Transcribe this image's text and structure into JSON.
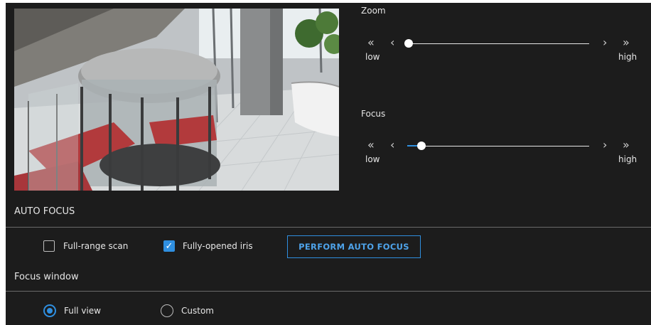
{
  "zoom": {
    "label": "Zoom",
    "low_label": "low",
    "high_label": "high",
    "level": 0.0
  },
  "focus": {
    "label": "Focus",
    "low_label": "low",
    "high_label": "high",
    "level": 0.07
  },
  "controls": {
    "far_left_glyph": "«",
    "left_glyph": "‹",
    "right_glyph": "›",
    "far_right_glyph": "»"
  },
  "auto_focus": {
    "title": "AUTO FOCUS",
    "full_range_scan_label": "Full-range scan",
    "full_range_scan_checked": false,
    "fully_opened_iris_label": "Fully-opened iris",
    "fully_opened_iris_checked": true,
    "button_label": "PERFORM AUTO FOCUS"
  },
  "focus_window": {
    "title": "Focus window",
    "options": [
      {
        "label": "Full view",
        "selected": true
      },
      {
        "label": "Custom",
        "selected": false
      }
    ]
  },
  "colors": {
    "accent": "#2f8fe0",
    "background": "#1c1c1c"
  }
}
